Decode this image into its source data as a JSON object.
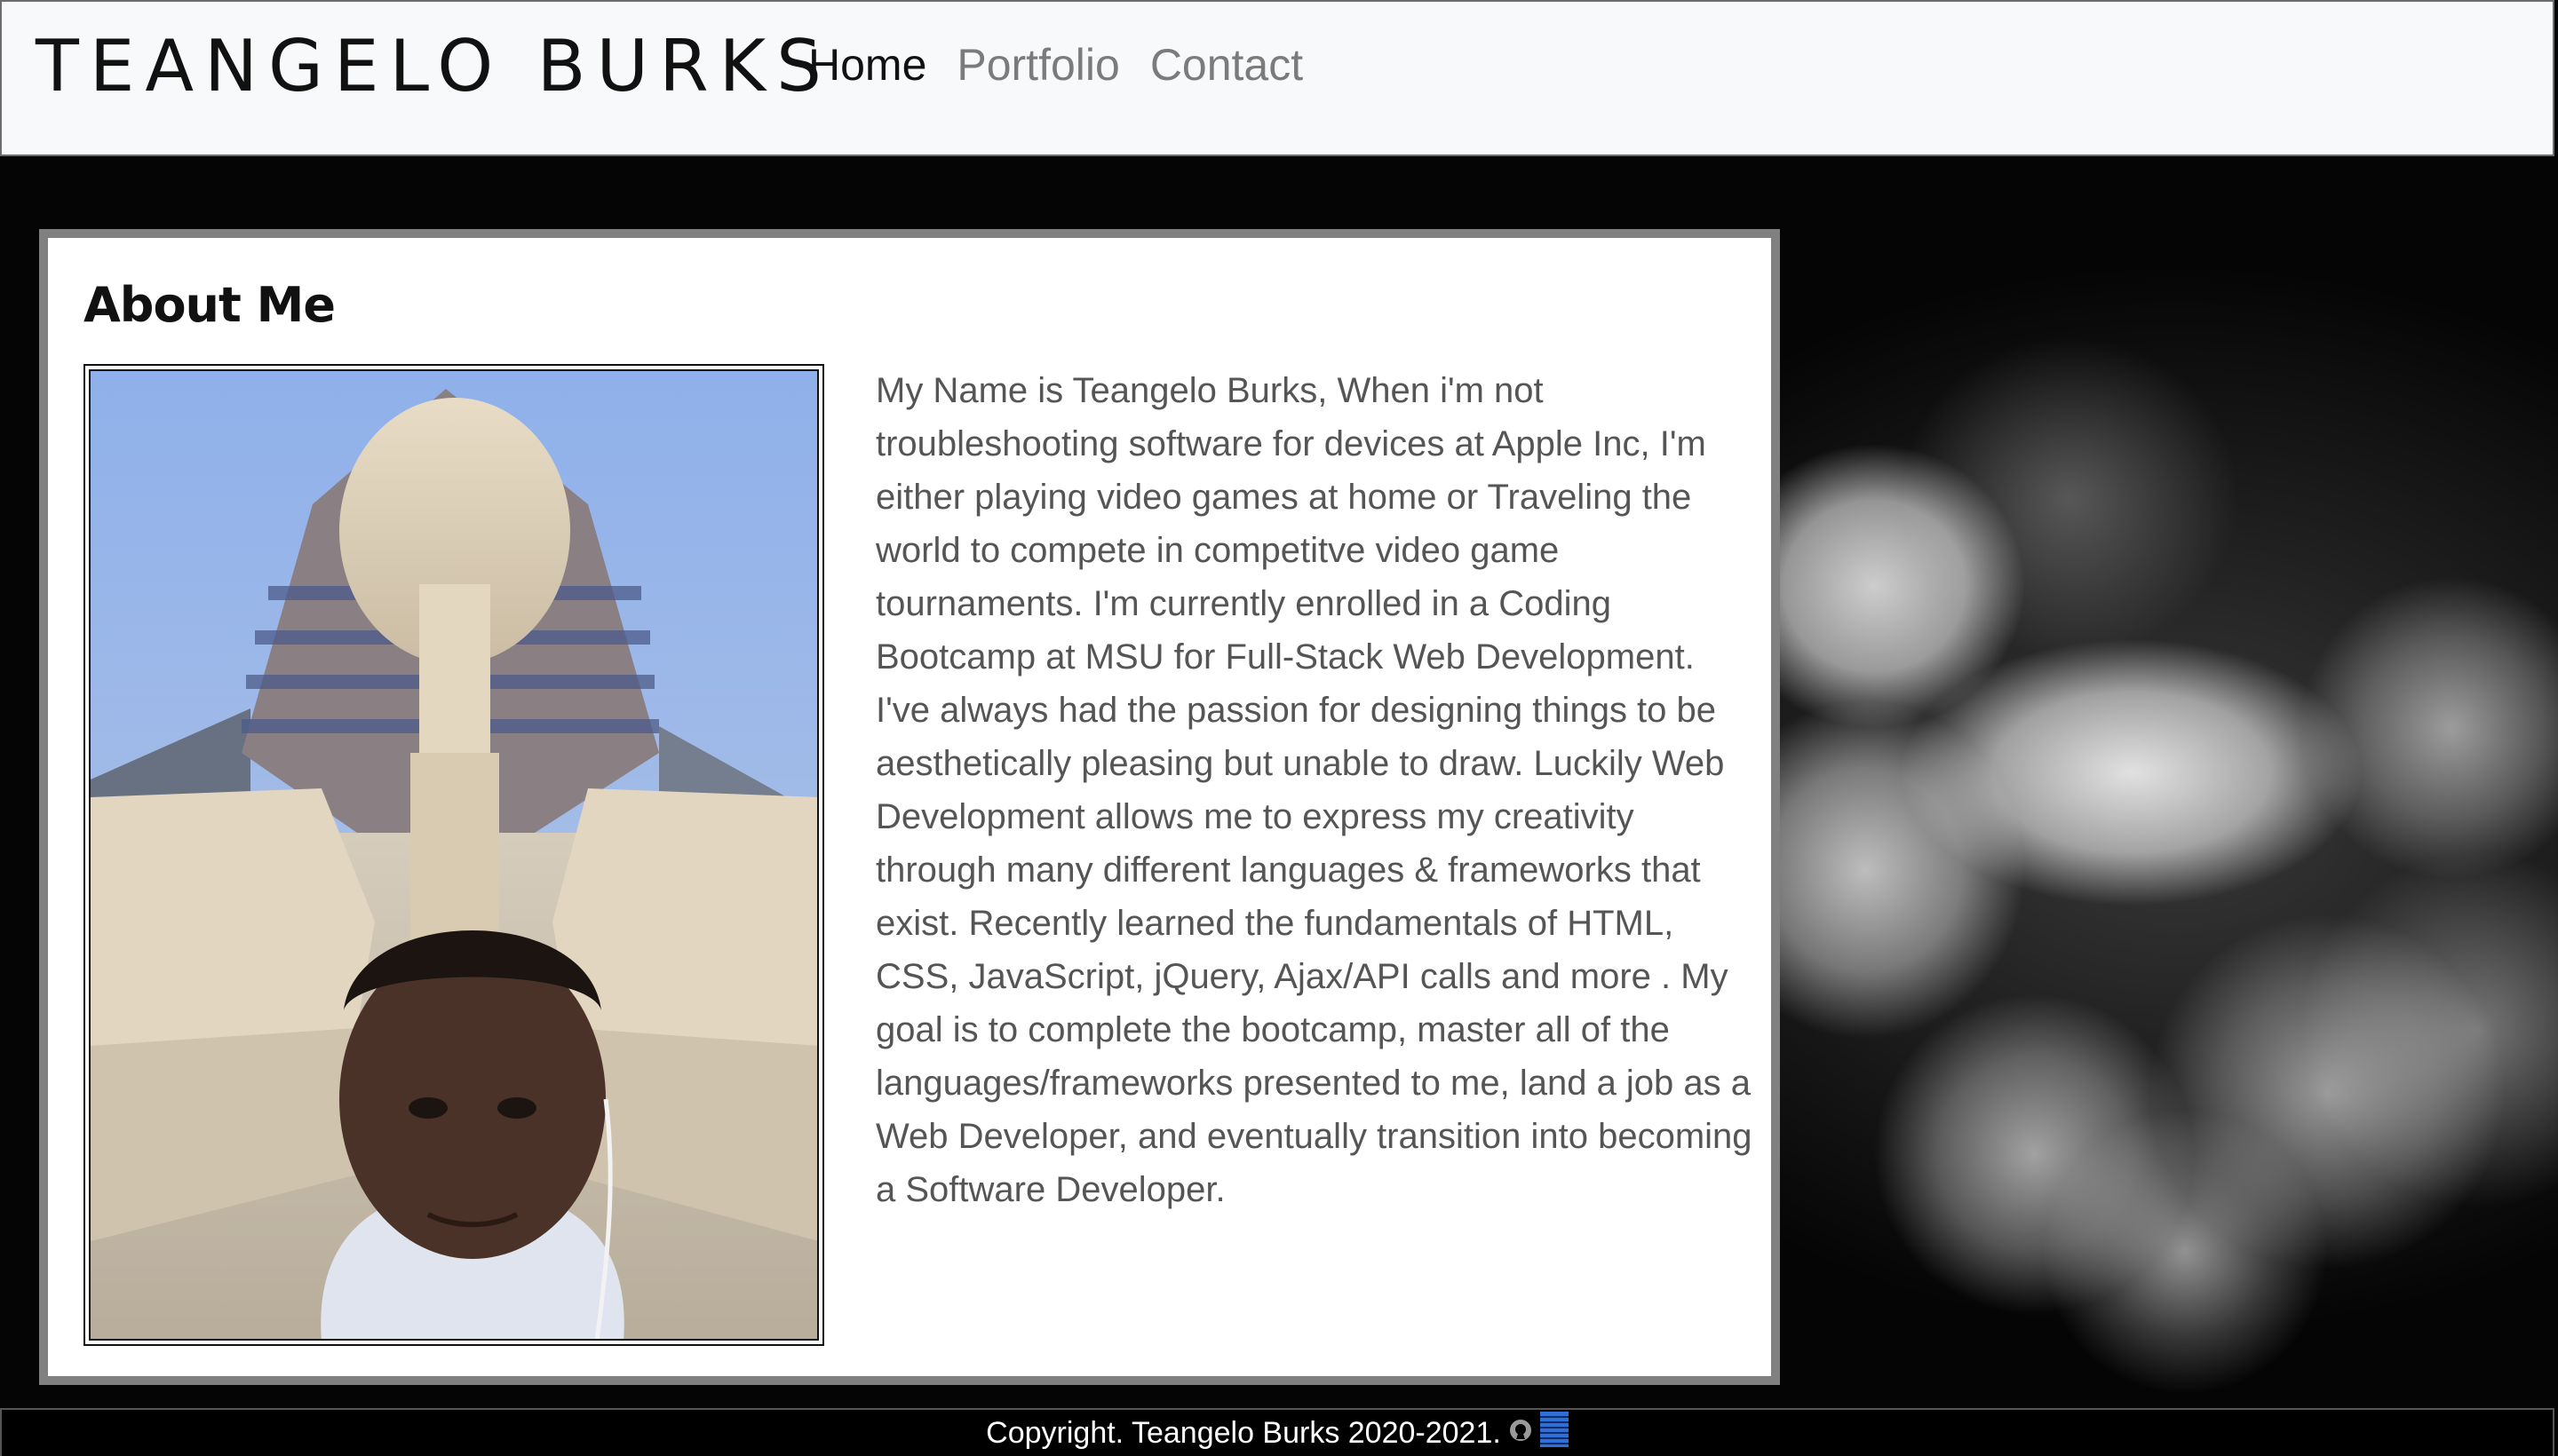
{
  "navbar": {
    "brand": "TEANGELO BURKS",
    "links": [
      {
        "label": "Home"
      },
      {
        "label": "Portfolio"
      },
      {
        "label": "Contact"
      }
    ]
  },
  "about": {
    "title": "About Me",
    "photo_icon": "profile-photo",
    "body": "My Name is Teangelo Burks, When i'm not troubleshooting software for devices at Apple Inc, I'm either playing video games at home or Traveling the world to compete in competitve video game tournaments. I'm currently enrolled in a Coding Bootcamp at MSU for Full-Stack Web Development. I've always had the passion for designing things to be aesthetically pleasing but unable to draw. Luckily Web Development allows me to express my creativity through many different languages & frameworks that exist. Recently learned the fundamentals of HTML, CSS, JavaScript, jQuery, Ajax/API calls and more . My goal is to complete the bootcamp, master all of the languages/frameworks presented to me, land a job as a Web Developer, and eventually transition into becoming a Software Developer."
  },
  "footer": {
    "copyright": "Copyright. Teangelo Burks 2020-2021.",
    "icons": [
      "github-icon",
      "linkedin-icon"
    ]
  },
  "colors": {
    "navbar_bg": "#f8f9fa",
    "nav_active": "#111111",
    "nav_inactive": "#7b7b7b",
    "card_border": "#808080",
    "text": "#555555",
    "footer_bg": "#000000",
    "linkedin_blue": "#2f6fd6"
  }
}
